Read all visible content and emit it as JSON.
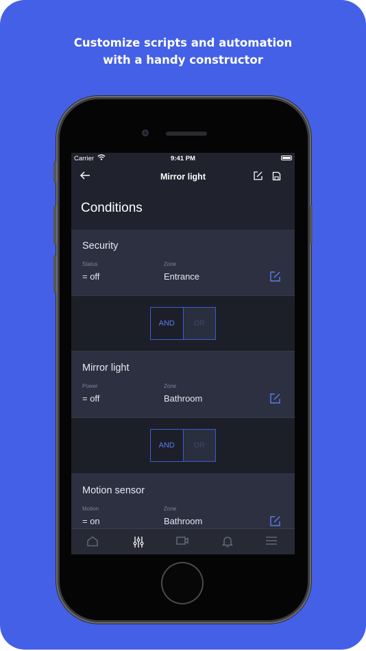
{
  "headline": {
    "line1": "Customize scripts and automation",
    "line2": "with a handy constructor"
  },
  "status_bar": {
    "carrier": "Carrier",
    "time": "9:41 PM"
  },
  "nav": {
    "title": "Mirror light"
  },
  "section_title": "Conditions",
  "conditions": [
    {
      "title": "Security",
      "field1_label": "Status",
      "field1_value": "= off",
      "field2_label": "Zone",
      "field2_value": "Entrance"
    },
    {
      "title": "Mirror light",
      "field1_label": "Power",
      "field1_value": "= off",
      "field2_label": "Zone",
      "field2_value": "Bathroom"
    },
    {
      "title": "Motion sensor",
      "field1_label": "Motion",
      "field1_value": "= on",
      "field2_label": "Zone",
      "field2_value": "Bathroom"
    }
  ],
  "operators": [
    {
      "and_label": "AND",
      "or_label": "OR",
      "selected": "AND"
    },
    {
      "and_label": "AND",
      "or_label": "OR",
      "selected": "AND"
    }
  ],
  "tab_bar": {
    "items": [
      "home-icon",
      "sliders-icon",
      "camera-icon",
      "bell-icon",
      "menu-icon"
    ],
    "active": "sliders-icon"
  },
  "colors": {
    "background": "#4460e6",
    "screen": "#20232d",
    "card": "#2c3040",
    "accent": "#5f7cf0"
  }
}
